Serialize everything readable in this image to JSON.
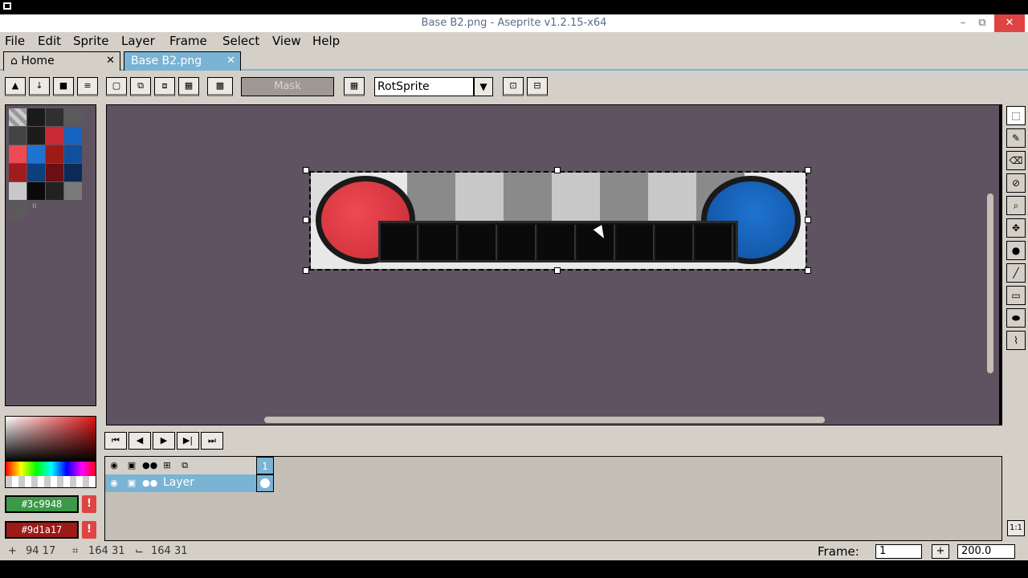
{
  "window": {
    "title": "Base B2.png - Aseprite v1.2.15-x64",
    "minimize": "–",
    "restore": "⧉",
    "close": "✕"
  },
  "menu": {
    "items": [
      "File",
      "Edit",
      "Sprite",
      "Layer",
      "Frame",
      "Select",
      "View",
      "Help"
    ]
  },
  "tabs": {
    "home": "Home",
    "active": "Base B2.png",
    "close": "✕"
  },
  "toolbar": {
    "mask_label": "Mask",
    "rotation_algorithm": "RotSprite"
  },
  "palette": {
    "colors": [
      "checker",
      "#1a1a1a",
      "#303030",
      "#5a5a5a",
      "#444444",
      "#1c1c1c",
      "#c82a35",
      "#1665c0",
      "#ee4a53",
      "#1f73d0",
      "#9d1a17",
      "#0f4f9c",
      "#a01c20",
      "#0e3f7d",
      "#6b0f12",
      "#0a2b55",
      "#c8c8c8",
      "#0a0a0a",
      "#222222",
      "#7a7a7a",
      "#5a5a5a"
    ],
    "end_marker": "ıı"
  },
  "colors": {
    "foreground": "#3c9948",
    "background": "#9d1a17",
    "foreground_hex_label": "#3c9948",
    "background_hex_label": "#9d1a17",
    "warning_glyph": "!"
  },
  "timeline": {
    "frame_number": "1",
    "layer_name": "Layer"
  },
  "status": {
    "cursor_pos": "94  17",
    "selection_size": "164  31",
    "sprite_size": "164  31",
    "frame_label": "Frame:",
    "frame_value": "1",
    "plus": "+",
    "zoom_value": "200.0",
    "one_to_one": "1:1"
  }
}
